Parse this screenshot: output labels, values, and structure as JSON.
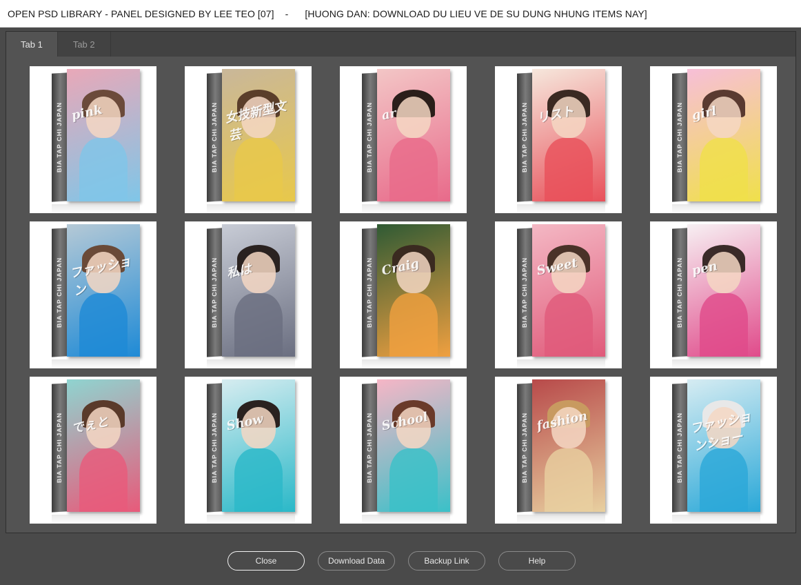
{
  "window": {
    "title": "OPEN PSD LIBRARY - PANEL DESIGNED BY LEE TEO [07]    -      [HUONG DAN: DOWNLOAD DU LIEU VE DE SU DUNG NHUNG ITEMS NAY]"
  },
  "tabs": [
    {
      "label": "Tab 1",
      "active": true
    },
    {
      "label": "Tab 2",
      "active": false
    }
  ],
  "spine_text": "BIA TAP CHI JAPAN",
  "items": [
    {
      "title": "pink",
      "bg": "#e9a8b8",
      "accent": "#7fc6e8",
      "hair": "#6b4a3a"
    },
    {
      "title": "女技新型文芸",
      "bg": "#c9b79a",
      "accent": "#e8c84a",
      "hair": "#5a3e2a"
    },
    {
      "title": "ar",
      "bg": "#f3c6c6",
      "accent": "#e86a8a",
      "hair": "#2a1e1a"
    },
    {
      "title": "リスト",
      "bg": "#f6e7dc",
      "accent": "#e8505a",
      "hair": "#3a2a22"
    },
    {
      "title": "girl",
      "bg": "#f7bfd8",
      "accent": "#f0e04a",
      "hair": "#5a3a30"
    },
    {
      "title": "ファッション",
      "bg": "#b5c9d6",
      "accent": "#1e8ad6",
      "hair": "#6a4a38"
    },
    {
      "title": "私は",
      "bg": "#c8ccd6",
      "accent": "#6a6e80",
      "hair": "#2a2220"
    },
    {
      "title": "Craig",
      "bg": "#2f5a34",
      "accent": "#f0a040",
      "hair": "#3a2a20"
    },
    {
      "title": "Sweet",
      "bg": "#f4b8c4",
      "accent": "#e05a7a",
      "hair": "#4a3228"
    },
    {
      "title": "pen",
      "bg": "#f7f0f3",
      "accent": "#e04a8a",
      "hair": "#3a2a28"
    },
    {
      "title": "でぇと",
      "bg": "#8fd4d0",
      "accent": "#e85a7a",
      "hair": "#5a3a2a"
    },
    {
      "title": "Show",
      "bg": "#d6ecf0",
      "accent": "#2ab8c8",
      "hair": "#2a2220"
    },
    {
      "title": "School",
      "bg": "#f6b6c6",
      "accent": "#3ac0c8",
      "hair": "#6a3a2a"
    },
    {
      "title": "fashion",
      "bg": "#b84a4a",
      "accent": "#e8d0a0",
      "hair": "#c89a60"
    },
    {
      "title": "ファッションショー",
      "bg": "#d6ecf2",
      "accent": "#2aa8d8",
      "hair": "#e8e8e8"
    }
  ],
  "buttons": {
    "close": "Close",
    "download": "Download Data",
    "backup": "Backup Link",
    "help": "Help"
  }
}
